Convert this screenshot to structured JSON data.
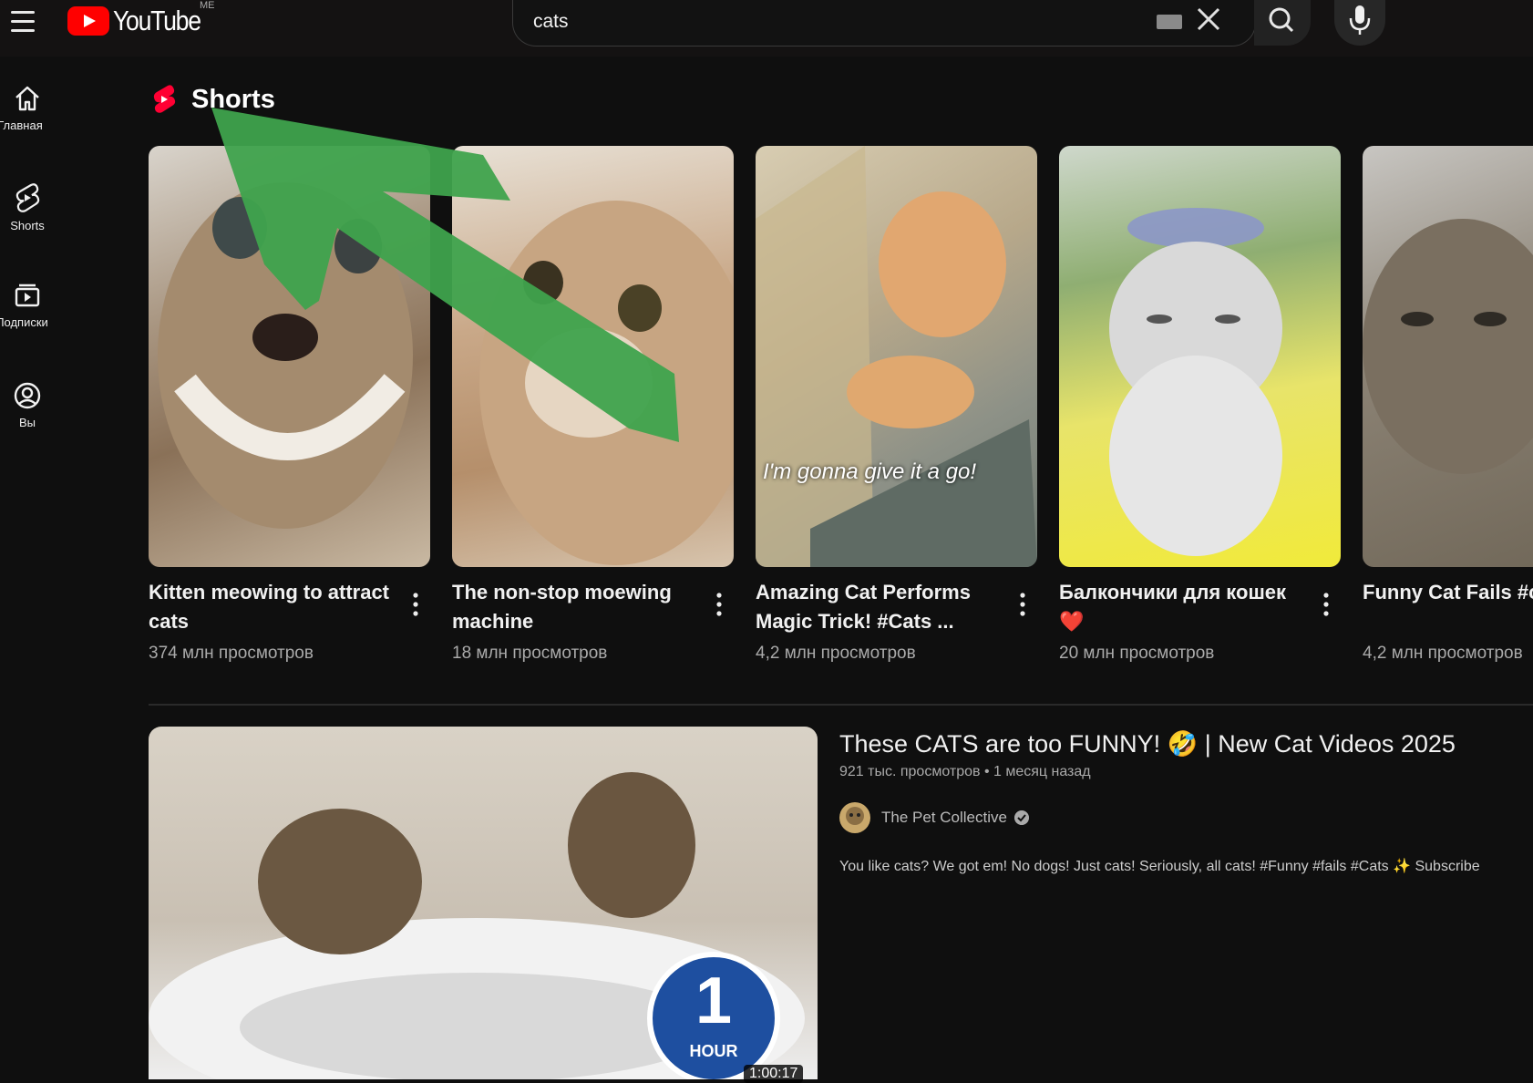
{
  "header": {
    "logo_text": "YouTube",
    "region": "ME",
    "search_value": "cats",
    "icons": [
      "menu-icon",
      "youtube-logo-icon",
      "keyboard-icon",
      "clear-icon",
      "search-icon",
      "mic-icon"
    ]
  },
  "sidebar": {
    "items": [
      {
        "label": "Главная",
        "icon": "home-icon"
      },
      {
        "label": "Shorts",
        "icon": "shorts-icon"
      },
      {
        "label": "Подписки",
        "icon": "subscriptions-icon"
      },
      {
        "label": "Вы",
        "icon": "you-icon"
      }
    ]
  },
  "shorts": {
    "section_title": "Shorts",
    "items": [
      {
        "title": "Kitten meowing to attract cats",
        "views": "374 млн просмотров"
      },
      {
        "title": "The non-stop moewing machine",
        "views": "18 млн просмотров"
      },
      {
        "title": "Amazing Cat Performs Magic Trick! #Cats ...",
        "views": "4,2 млн просмотров",
        "overlay": "I'm gonna give it a go!"
      },
      {
        "title": "Балкончики для кошек ❤️",
        "views": "20 млн просмотров"
      },
      {
        "title": "Funny Cat Fails #catfails",
        "views": "4,2 млн просмотров"
      }
    ]
  },
  "video": {
    "title": "These CATS are too FUNNY! 🤣 | New Cat Videos 2025",
    "meta": "921 тыс. просмотров • 1 месяц назад",
    "channel": "The Pet Collective",
    "description": "You like cats? We got em! No dogs! Just cats! Seriously, all cats! #Funny #fails #Cats ✨ Subscribe",
    "badge_number": "1",
    "badge_text": "HOUR",
    "duration": "1:00:17"
  },
  "colors": {
    "background": "#0f0f0f",
    "brand_red": "#ff0000",
    "annotation_arrow": "#3fa34d"
  }
}
